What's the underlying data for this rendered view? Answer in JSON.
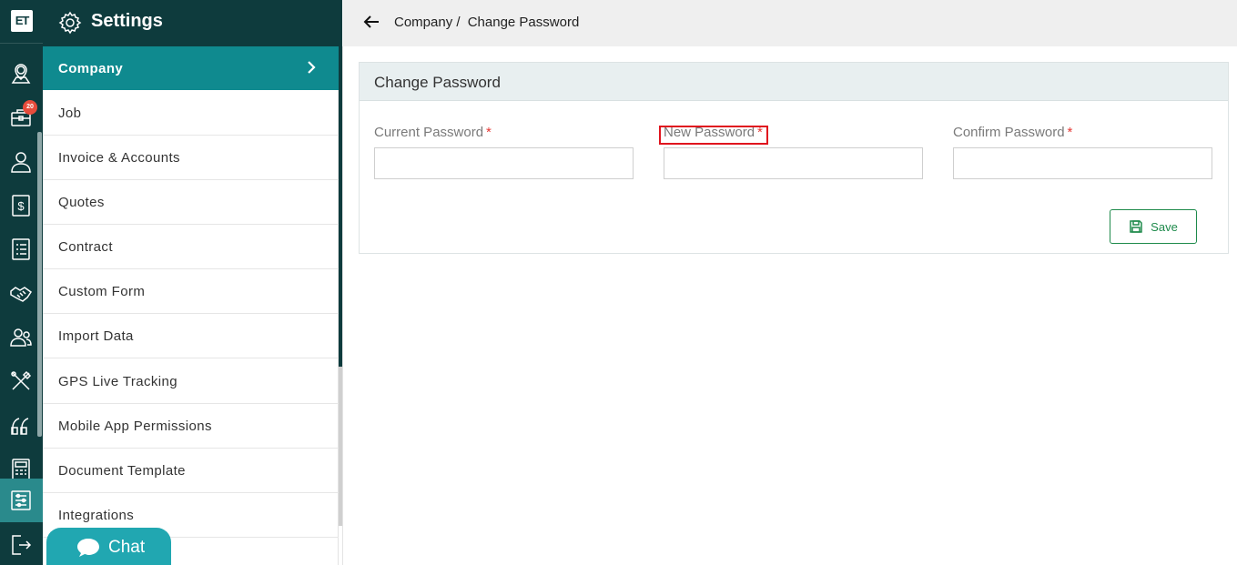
{
  "app": {
    "logo_text": "ET"
  },
  "rail": {
    "badge_count": "20",
    "icons": [
      "map-pin-icon",
      "briefcase-icon",
      "user-icon",
      "dollar-icon",
      "list-icon",
      "handshake-icon",
      "users-icon",
      "tools-icon",
      "quote-icon",
      "calculator-icon",
      "settings-sliders-icon",
      "logout-icon"
    ]
  },
  "settings": {
    "title": "Settings",
    "items": [
      {
        "label": "Company"
      },
      {
        "label": "Job"
      },
      {
        "label": "Invoice & Accounts"
      },
      {
        "label": "Quotes"
      },
      {
        "label": "Contract"
      },
      {
        "label": "Custom Form"
      },
      {
        "label": "Import Data"
      },
      {
        "label": "GPS Live Tracking"
      },
      {
        "label": "Mobile App Permissions"
      },
      {
        "label": "Document Template"
      },
      {
        "label": "Integrations"
      }
    ]
  },
  "chat": {
    "label": "Chat"
  },
  "breadcrumb": {
    "parent": "Company /",
    "current": "Change Password"
  },
  "form": {
    "title": "Change Password",
    "current_password": {
      "label": "Current Password",
      "required": "*",
      "value": ""
    },
    "new_password": {
      "label": "New Password",
      "required": "*",
      "value": ""
    },
    "confirm_password": {
      "label": "Confirm Password",
      "required": "*",
      "value": ""
    },
    "save_label": "Save"
  },
  "colors": {
    "dark": "#0e3b3d",
    "accent": "#0f8a8f",
    "chat": "#21a7b1",
    "save": "#1e8a4b",
    "required": "#e53935",
    "highlight": "#e0141e"
  }
}
